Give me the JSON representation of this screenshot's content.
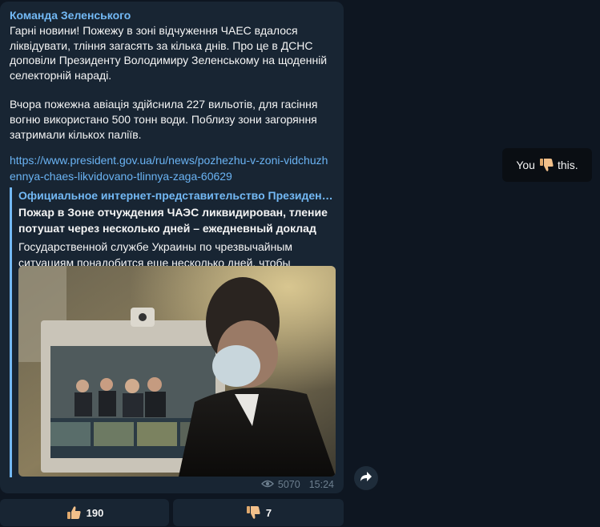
{
  "post": {
    "channel_name": "Команда Зеленського",
    "paragraph1": "Гарні новини! Пожежу в зоні відчуження ЧАЕС вдалося ліквідувати, тління загасять за кілька днів. Про це в ДСНС доповіли Президенту Володимиру Зеленському на щоденній селекторній нараді.",
    "paragraph2": "Вчора пожежна авіація здійснила 227 вильотів, для гасіння вогню використано 500 тонн води. Поблизу зони загоряння затримали кількох паліїв.",
    "link": "https://www.president.gov.ua/ru/news/pozhezhu-v-zoni-vidchuzhennya-chaes-likvidovano-tlinnya-zaga-60629",
    "preview": {
      "site": "Официальное интернет-представительство Президента Украины",
      "title": "Пожар в Зоне отчуждения ЧАЭС ликвидирован, тление потушат через несколько дней – ежедневный доклад Президенту",
      "description": "Государственной службе Украины по чрезвычайным ситуациям понадобится еще несколько дней, чтобы потушить тление"
    },
    "views": "5070",
    "time": "15:24"
  },
  "reactions": {
    "like": {
      "icon": "thumbs-up-icon",
      "count": "190"
    },
    "dislike": {
      "icon": "thumbs-down-icon",
      "count": "7"
    }
  },
  "you_reacted": {
    "prefix": "You",
    "suffix": "this.",
    "icon": "thumbs-down-icon"
  },
  "colors": {
    "background": "#0e1621",
    "bubble": "#182533",
    "accent": "#73b9f5",
    "link": "#6ab3f3",
    "meta": "#6d7f8f"
  }
}
